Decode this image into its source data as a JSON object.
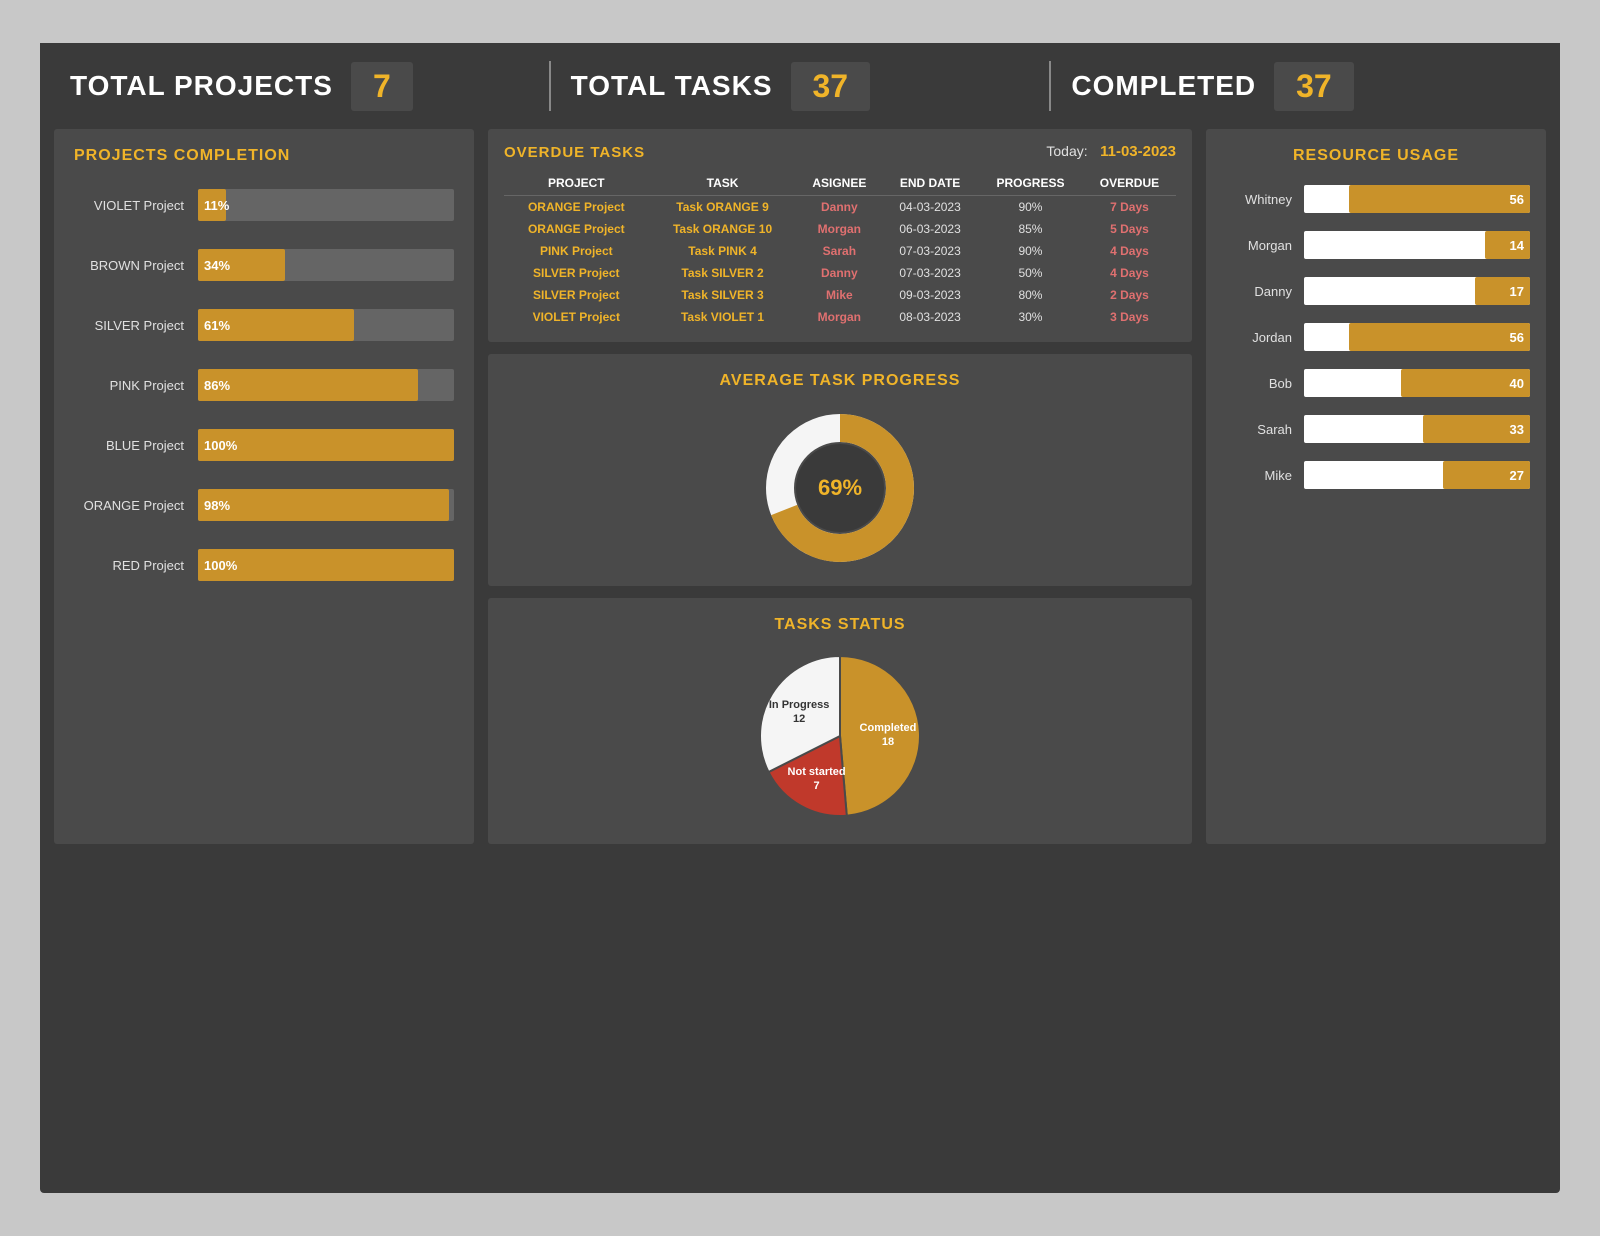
{
  "header": {
    "total_projects_label": "TOTAL PROJECTS",
    "total_projects_value": "7",
    "total_tasks_label": "TOTAL TASKS",
    "total_tasks_value": "37",
    "completed_label": "COMPLETED",
    "completed_value": "37"
  },
  "projects_completion": {
    "title": "PROJECTS COMPLETION",
    "bars": [
      {
        "label": "VIOLET Project",
        "pct": 11,
        "pct_label": "11%"
      },
      {
        "label": "BROWN Project",
        "pct": 34,
        "pct_label": "34%"
      },
      {
        "label": "SILVER Project",
        "pct": 61,
        "pct_label": "61%"
      },
      {
        "label": "PINK Project",
        "pct": 86,
        "pct_label": "86%"
      },
      {
        "label": "BLUE Project",
        "pct": 100,
        "pct_label": "100%"
      },
      {
        "label": "ORANGE Project",
        "pct": 98,
        "pct_label": "98%"
      },
      {
        "label": "RED Project",
        "pct": 100,
        "pct_label": "100%"
      }
    ]
  },
  "overdue_tasks": {
    "title": "OVERDUE TASKS",
    "today_label": "Today:",
    "today_date": "11-03-2023",
    "columns": [
      "PROJECT",
      "TASK",
      "ASIGNEE",
      "END DATE",
      "PROGRESS",
      "OVERDUE"
    ],
    "rows": [
      {
        "project": "ORANGE Project",
        "task": "Task ORANGE 9",
        "assignee": "Danny",
        "end_date": "04-03-2023",
        "progress": "90%",
        "overdue": "7 Days"
      },
      {
        "project": "ORANGE Project",
        "task": "Task ORANGE 10",
        "assignee": "Morgan",
        "end_date": "06-03-2023",
        "progress": "85%",
        "overdue": "5 Days"
      },
      {
        "project": "PINK Project",
        "task": "Task PINK 4",
        "assignee": "Sarah",
        "end_date": "07-03-2023",
        "progress": "90%",
        "overdue": "4 Days"
      },
      {
        "project": "SILVER Project",
        "task": "Task SILVER 2",
        "assignee": "Danny",
        "end_date": "07-03-2023",
        "progress": "50%",
        "overdue": "4 Days"
      },
      {
        "project": "SILVER Project",
        "task": "Task SILVER 3",
        "assignee": "Mike",
        "end_date": "09-03-2023",
        "progress": "80%",
        "overdue": "2 Days"
      },
      {
        "project": "VIOLET Project",
        "task": "Task VIOLET 1",
        "assignee": "Morgan",
        "end_date": "08-03-2023",
        "progress": "30%",
        "overdue": "3 Days"
      }
    ]
  },
  "avg_task_progress": {
    "title": "AVERAGE TASK PROGRESS",
    "value": "69%",
    "pct": 69
  },
  "tasks_status": {
    "title": "TASKS STATUS",
    "segments": [
      {
        "label": "Completed\n18",
        "value": 18,
        "color": "#c9922a"
      },
      {
        "label": "Not started\n7",
        "value": 7,
        "color": "#c0392b"
      },
      {
        "label": "In Progress\n12",
        "value": 12,
        "color": "#f5f5f5"
      }
    ],
    "legend": [
      {
        "label": "Completed 18",
        "color": "#c9922a"
      },
      {
        "label": "Not started 7",
        "color": "#c0392b"
      },
      {
        "label": "In Progress 12",
        "color": "#f5f5f5"
      }
    ]
  },
  "resource_usage": {
    "title": "RESOURCE USAGE",
    "resources": [
      {
        "name": "Whitney",
        "value": 56
      },
      {
        "name": "Morgan",
        "value": 14
      },
      {
        "name": "Danny",
        "value": 17
      },
      {
        "name": "Jordan",
        "value": 56
      },
      {
        "name": "Bob",
        "value": 40
      },
      {
        "name": "Sarah",
        "value": 33
      },
      {
        "name": "Mike",
        "value": 27
      }
    ],
    "max_value": 70
  }
}
